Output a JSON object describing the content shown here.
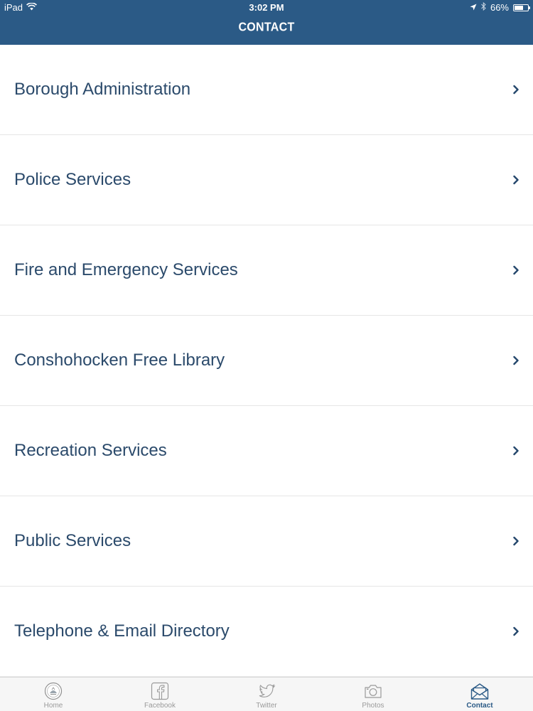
{
  "status_bar": {
    "device": "iPad",
    "time": "3:02 PM",
    "battery": "66%",
    "battery_level": 0.66,
    "icons": [
      "wifi-icon",
      "location-icon",
      "bluetooth-icon",
      "battery-icon"
    ]
  },
  "nav": {
    "title": "CONTACT"
  },
  "list": {
    "items": [
      {
        "label": "Borough Administration"
      },
      {
        "label": "Police Services"
      },
      {
        "label": "Fire and Emergency Services"
      },
      {
        "label": "Conshohocken Free Library"
      },
      {
        "label": "Recreation Services"
      },
      {
        "label": "Public Services"
      },
      {
        "label": "Telephone & Email Directory"
      }
    ]
  },
  "tabs": [
    {
      "label": "Home",
      "icon": "home-seal-icon",
      "active": false
    },
    {
      "label": "Facebook",
      "icon": "facebook-icon",
      "active": false
    },
    {
      "label": "Twitter",
      "icon": "twitter-icon",
      "active": false
    },
    {
      "label": "Photos",
      "icon": "camera-icon",
      "active": false
    },
    {
      "label": "Contact",
      "icon": "envelope-icon",
      "active": true
    }
  ],
  "colors": {
    "accent": "#2b5a86",
    "text": "#2b4a6b",
    "divider": "#e6e6e6",
    "tab_inactive": "#9a9a9a"
  }
}
